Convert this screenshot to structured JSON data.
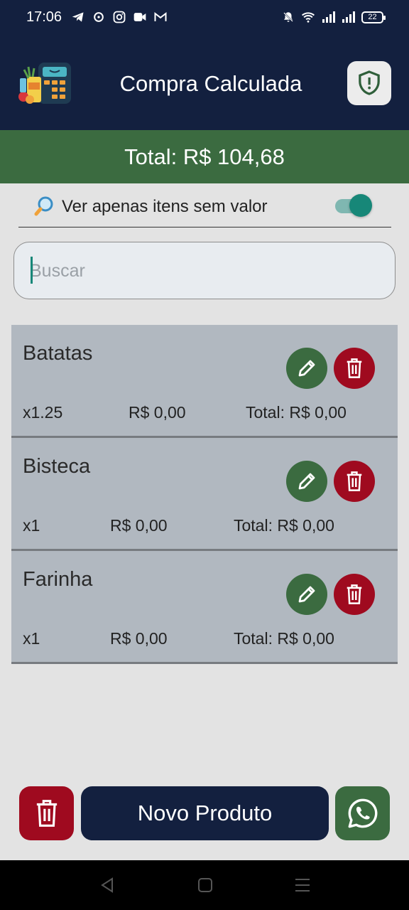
{
  "status_bar": {
    "time": "17:06",
    "battery": "22",
    "notification_icons": [
      "telegram-icon",
      "sync-icon",
      "instagram-icon",
      "video-icon",
      "gmail-icon"
    ]
  },
  "header": {
    "title": "Compra Calculada",
    "logo_icon": "calculator-groceries-icon",
    "action_icon": "shield-alert-icon"
  },
  "summary": {
    "total_label": "Total: R$ 104,68"
  },
  "filter": {
    "icon": "magnifier-emoji",
    "label": "Ver apenas itens sem valor",
    "enabled": true
  },
  "search": {
    "placeholder": "Buscar",
    "value": ""
  },
  "items": [
    {
      "name": "Batatas",
      "qty": "x1.25",
      "price": "R$ 0,00",
      "total": "Total: R$ 0,00"
    },
    {
      "name": "Bisteca",
      "qty": "x1",
      "price": "R$ 0,00",
      "total": "Total: R$ 0,00"
    },
    {
      "name": "Farinha",
      "qty": "x1",
      "price": "R$ 0,00",
      "total": "Total: R$ 0,00"
    }
  ],
  "bottom_bar": {
    "new_product_label": "Novo Produto",
    "clear_icon": "trash-icon",
    "share_icon": "whatsapp-icon"
  },
  "colors": {
    "primary_navy": "#13203f",
    "accent_green": "#3b6b40",
    "danger_red": "#9f0a1f",
    "toggle_teal": "#178778"
  }
}
